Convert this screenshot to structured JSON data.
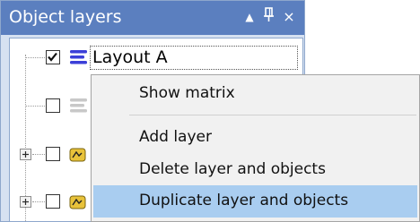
{
  "panel": {
    "title": "Object layers",
    "buttons": {
      "dropdown": "▲",
      "pin": "ᵖ",
      "close": "×"
    }
  },
  "tree": {
    "rows": [
      {
        "label": "Layout A",
        "checked": true,
        "icon": "layer-stack-icon",
        "expandable": false
      },
      {
        "label": "",
        "checked": false,
        "icon": "layer-stack-icon",
        "expandable": false
      },
      {
        "label": "",
        "checked": false,
        "icon": "object-group-icon",
        "expandable": true
      },
      {
        "label": "",
        "checked": false,
        "icon": "object-group-icon",
        "expandable": true
      }
    ]
  },
  "context_menu": {
    "items": [
      {
        "label": "Show matrix",
        "highlighted": false
      },
      {
        "label": "Add layer",
        "highlighted": false
      },
      {
        "label": "Delete layer and objects",
        "highlighted": false
      },
      {
        "label": "Duplicate layer and objects",
        "highlighted": true
      }
    ]
  },
  "colors": {
    "header_bg": "#5b7fbf",
    "panel_bg": "#d6e1f1",
    "menu_bg": "#f1f1f1",
    "menu_highlight": "#a9cdf0",
    "layer_icon_active": "#3b3fd8",
    "layer_icon_inactive": "#c8c8c8",
    "group_icon": "#e8c23a"
  }
}
